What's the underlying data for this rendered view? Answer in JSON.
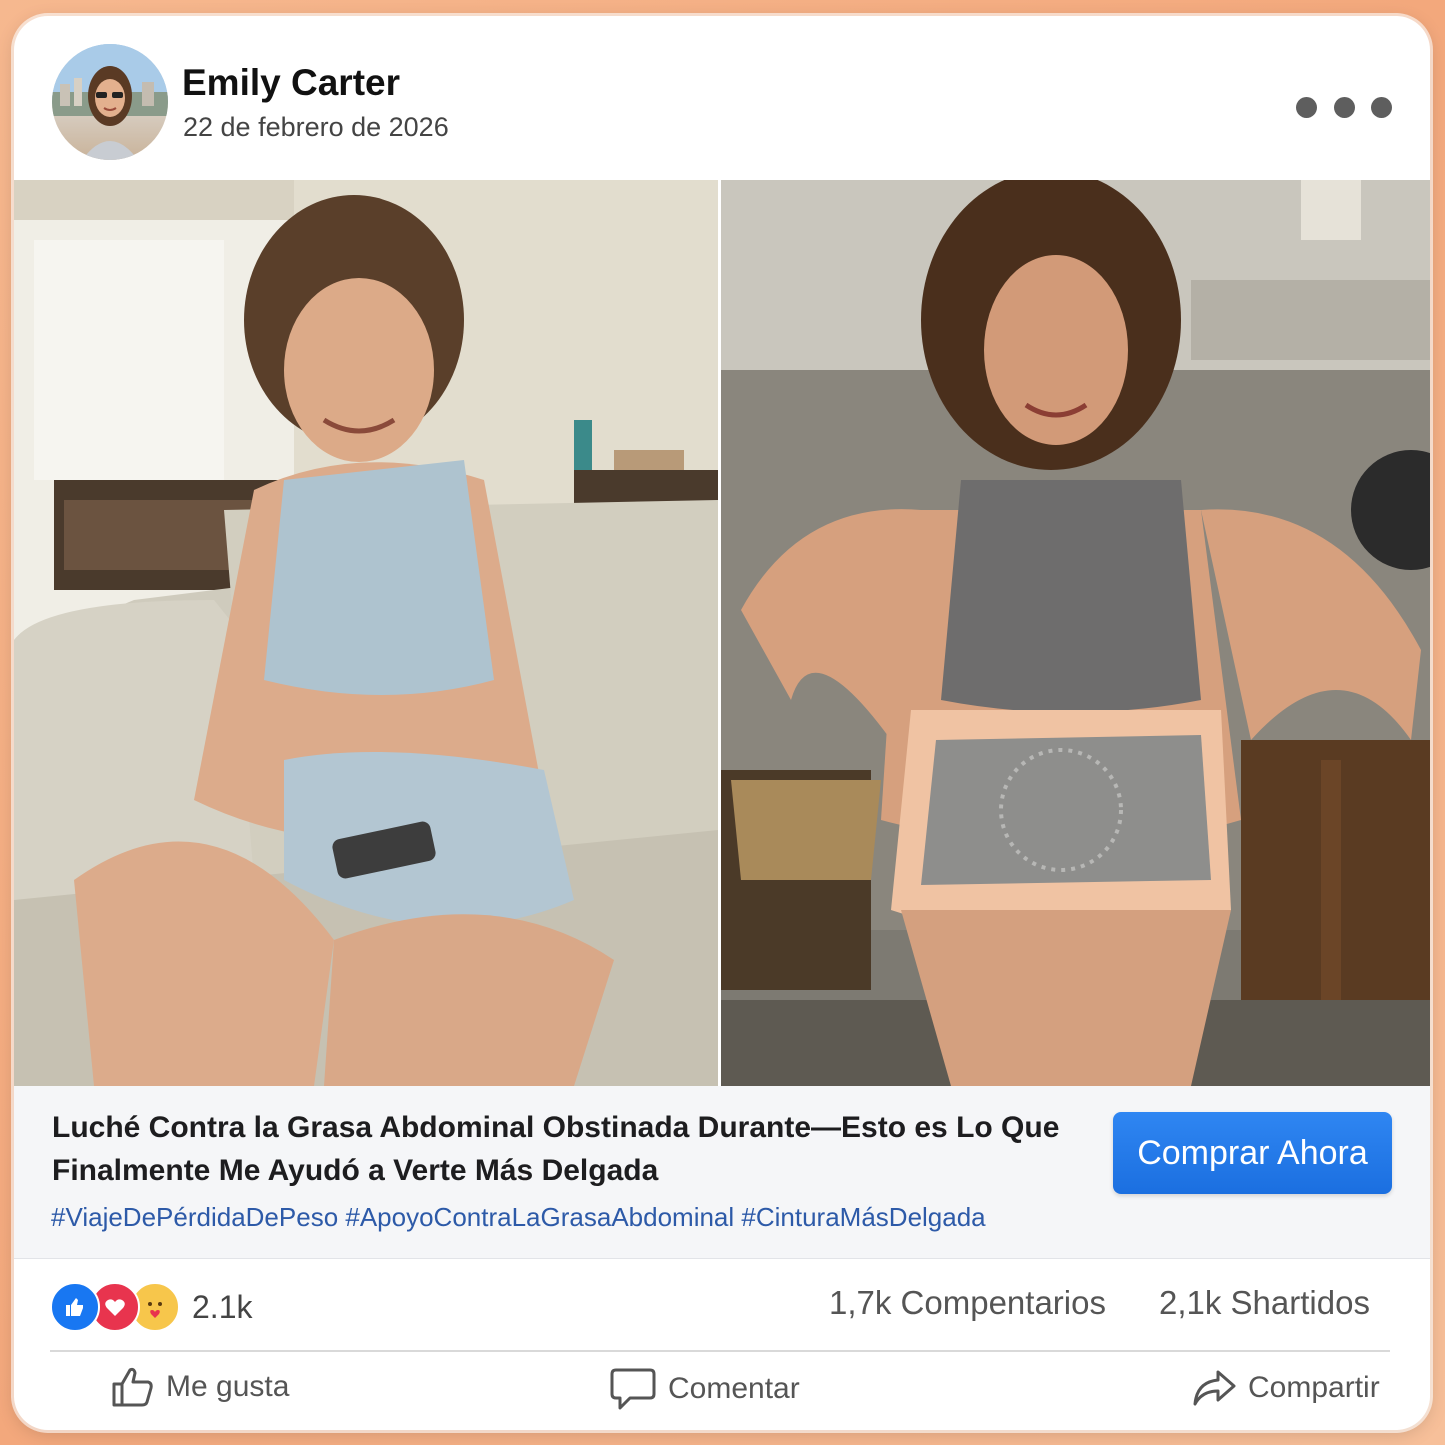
{
  "post": {
    "author": "Emily Carter",
    "date": "22 de febrero de 2026",
    "more_icon": "more-dots-icon"
  },
  "photos": {
    "before_alt": "before",
    "after_alt": "after"
  },
  "caption": {
    "headline": "Luché Contra la Grasa Abdominal Obstinada Durante—Esto es Lo Que Finalmente Me Ayudó a Verte Más Delgada",
    "hashtags": "#ViajeDePérdidaDePeso #ApoyoContraLaGrasaAbdominal #CinturaMásDelgada",
    "cta_label": "Comprar Ahora",
    "cta_color": "#1b6fe0"
  },
  "stats": {
    "reaction_count": "2.1k",
    "comments": "1,7k Compentarios",
    "shares": "2,1k Shartidos",
    "reaction_icons": [
      "like-reaction-icon",
      "love-reaction-icon",
      "care-reaction-icon"
    ]
  },
  "actions": {
    "like_label": "Me gusta",
    "comment_label": "Comentar",
    "share_label": "Compartir"
  }
}
